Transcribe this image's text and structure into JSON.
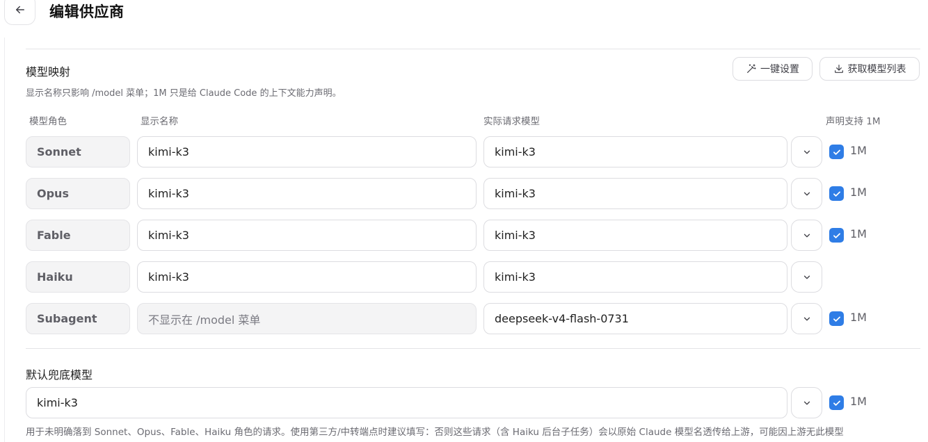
{
  "header": {
    "title": "编辑供应商",
    "back_icon": "arrow-left-icon"
  },
  "mapping": {
    "title": "模型映射",
    "description": "显示名称只影响 /model 菜单；1M 只是给 Claude Code 的上下文能力声明。",
    "one_click_label": "一键设置",
    "one_click_icon": "magic-wand-icon",
    "fetch_label": "获取模型列表",
    "fetch_icon": "download-icon",
    "columns": {
      "role": "模型角色",
      "display_name": "显示名称",
      "request_model": "实际请求模型",
      "declare_1m": "声明支持 1M"
    },
    "rows": [
      {
        "role": "Sonnet",
        "display_name": "kimi-k3",
        "request_model": "kimi-k3",
        "checked": true,
        "check_label": "1M"
      },
      {
        "role": "Opus",
        "display_name": "kimi-k3",
        "request_model": "kimi-k3",
        "checked": true,
        "check_label": "1M"
      },
      {
        "role": "Fable",
        "display_name": "kimi-k3",
        "request_model": "kimi-k3",
        "checked": true,
        "check_label": "1M"
      },
      {
        "role": "Haiku",
        "display_name": "kimi-k3",
        "request_model": "kimi-k3",
        "checked": false,
        "check_label": ""
      },
      {
        "role": "Subagent",
        "display_name": "不显示在 /model 菜单",
        "request_model": "deepseek-v4-flash-0731",
        "checked": true,
        "check_label": "1M"
      }
    ]
  },
  "fallback": {
    "title": "默认兜底模型",
    "value": "kimi-k3",
    "checked": true,
    "check_label": "1M",
    "note": "用于未明确落到 Sonnet、Opus、Fable、Haiku 角色的请求。使用第三方/中转端点时建议填写：否则这些请求（含 Haiku 后台子任务）会以原始 Claude 模型名透传给上游，可能因上游无此模型"
  },
  "colors": {
    "accent": "#2f7de6",
    "border": "#dcdce0",
    "muted_bg": "#f4f4f5",
    "muted_text": "#6b6b72"
  }
}
